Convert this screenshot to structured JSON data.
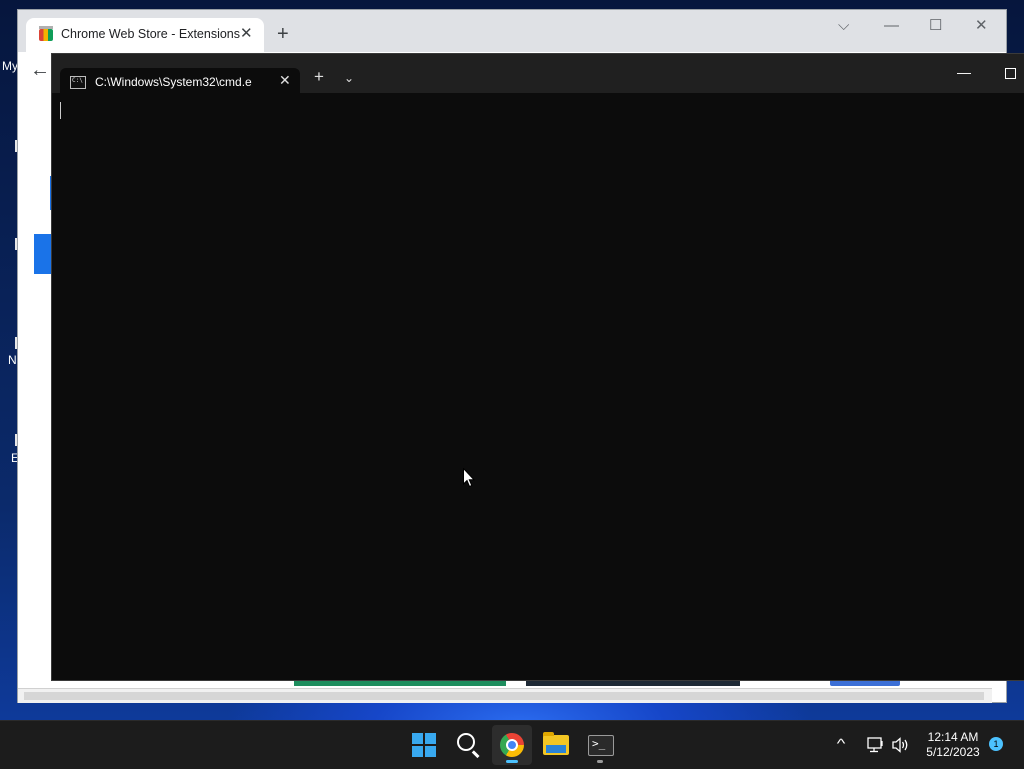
{
  "desktop": {
    "icon_labels": [
      "My",
      "N",
      "E"
    ]
  },
  "chrome": {
    "tab_title": "Chrome Web Store - Extensions",
    "tab_close": "✕",
    "new_tab": "+",
    "controls": {
      "dropdown": "⌵",
      "minimize": "—",
      "maximize": "☐",
      "close": "✕"
    },
    "back": "←"
  },
  "terminal": {
    "tab_title": "C:\\Windows\\System32\\cmd.e",
    "tab_close": "✕",
    "new_tab": "+",
    "dropdown": "⌄",
    "minimize": "—",
    "content": ""
  },
  "taskbar": {
    "apps": [
      "start-icon",
      "search-icon",
      "chrome-icon",
      "file-explorer-icon",
      "terminal-icon"
    ],
    "tray": {
      "chevron": "^",
      "time": "12:14 AM",
      "date": "5/12/2023",
      "notification_count": "1"
    }
  },
  "colors": {
    "taskbar_bg": "#1c1c1c",
    "terminal_bg": "#0c0c0c",
    "accent": "#4cc2ff",
    "chrome_blue": "#1a73e8"
  }
}
